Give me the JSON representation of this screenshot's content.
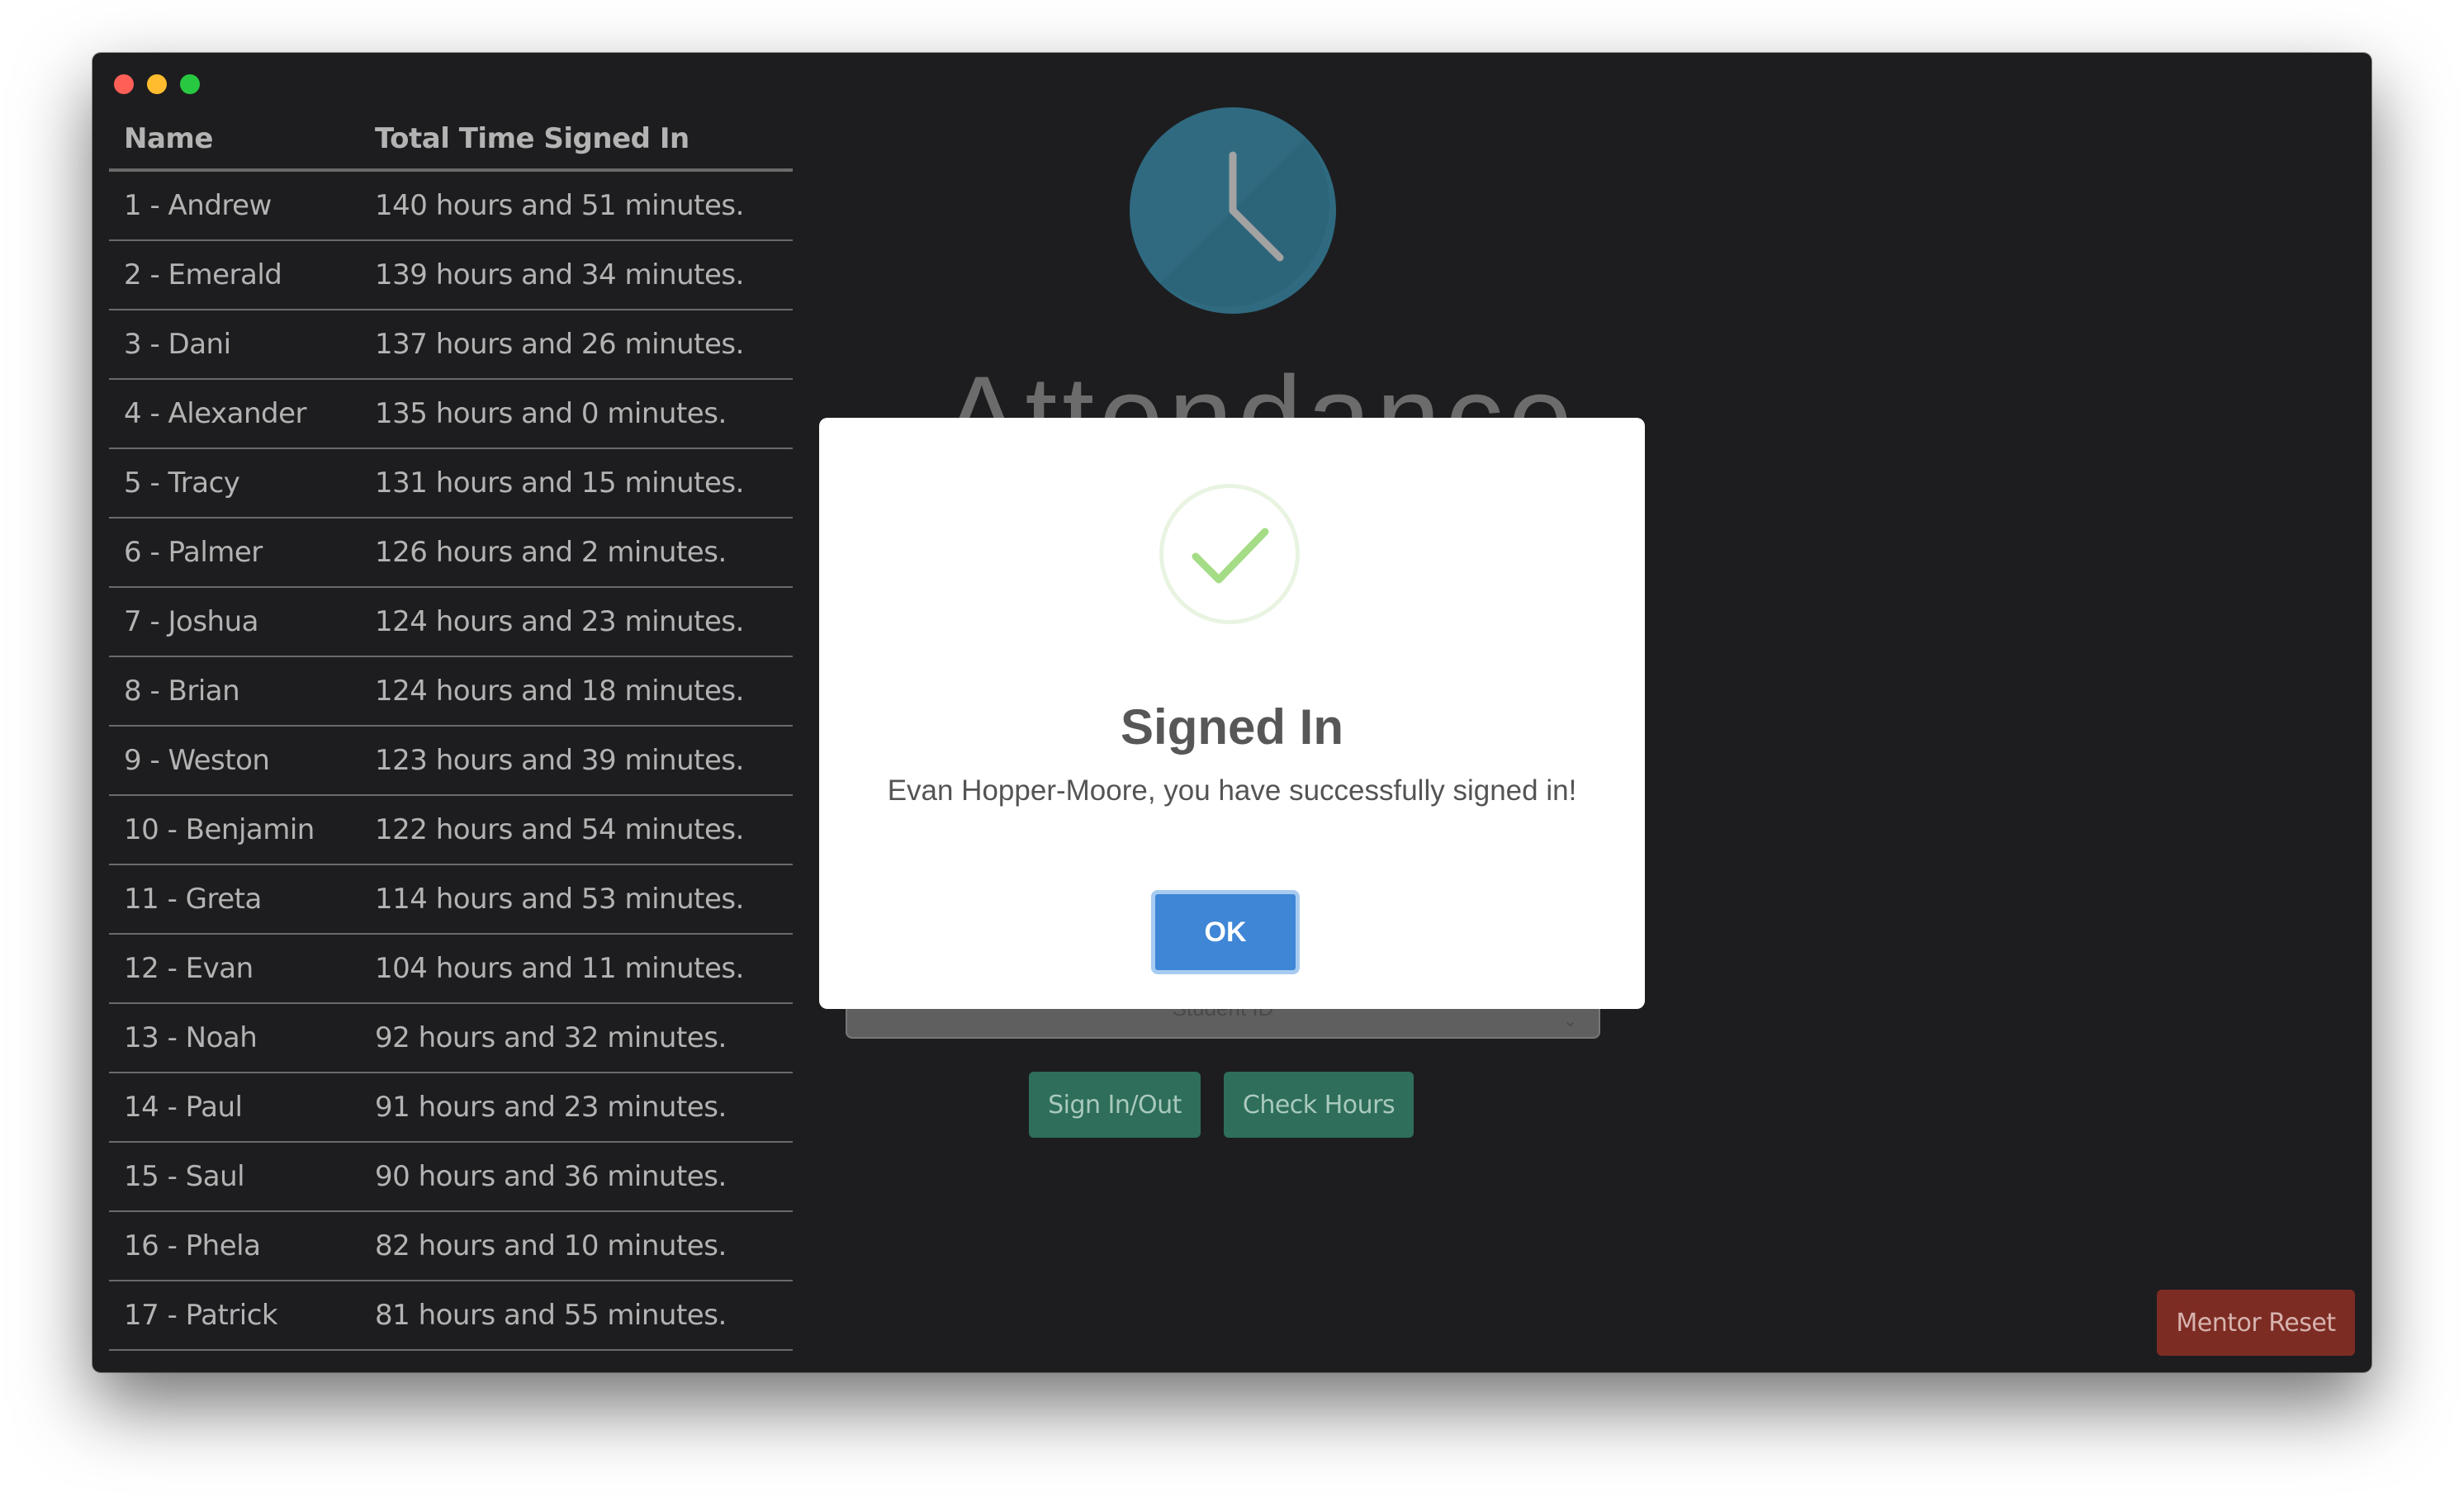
{
  "leaderboard": {
    "headers": {
      "name": "Name",
      "time": "Total Time Signed In"
    },
    "rows": [
      {
        "name": "1 - Andrew",
        "time": "140 hours and 51 minutes."
      },
      {
        "name": "2 - Emerald",
        "time": "139 hours and 34 minutes."
      },
      {
        "name": "3 - Dani",
        "time": "137 hours and 26 minutes."
      },
      {
        "name": "4 - Alexander",
        "time": "135 hours and 0 minutes."
      },
      {
        "name": "5 - Tracy",
        "time": "131 hours and 15 minutes."
      },
      {
        "name": "6 - Palmer",
        "time": "126 hours and 2 minutes."
      },
      {
        "name": "7 - Joshua",
        "time": "124 hours and 23 minutes."
      },
      {
        "name": "8 - Brian",
        "time": "124 hours and 18 minutes."
      },
      {
        "name": "9 - Weston",
        "time": "123 hours and 39 minutes."
      },
      {
        "name": "10 - Benjamin",
        "time": "122 hours and 54 minutes."
      },
      {
        "name": "11 - Greta",
        "time": "114 hours and 53 minutes."
      },
      {
        "name": "12 - Evan",
        "time": "104 hours and 11 minutes."
      },
      {
        "name": "13 - Noah",
        "time": "92 hours and 32 minutes."
      },
      {
        "name": "14 - Paul",
        "time": "91 hours and 23 minutes."
      },
      {
        "name": "15 - Saul",
        "time": "90 hours and 36 minutes."
      },
      {
        "name": "16 - Phela",
        "time": "82 hours and 10 minutes."
      },
      {
        "name": "17 - Patrick",
        "time": "81 hours and 55 minutes."
      }
    ]
  },
  "main": {
    "title": "Attendance",
    "clock_icon": "clock-icon",
    "student_input_placeholder": "Student ID",
    "sign_in_out_label": "Sign In/Out",
    "check_hours_label": "Check Hours"
  },
  "footer": {
    "mentor_reset_label": "Mentor Reset"
  },
  "modal": {
    "icon": "checkmark-icon",
    "title": "Signed In",
    "message": "Evan Hopper-Moore, you have successfully signed in!",
    "ok_label": "OK"
  },
  "colors": {
    "window_bg": "#1d1d1f",
    "clock": "#2f6a80",
    "green_button": "#2e6e5a",
    "reset_button": "#7d2c24",
    "ok_button": "#3f86d6",
    "check": "#a5dc86"
  }
}
